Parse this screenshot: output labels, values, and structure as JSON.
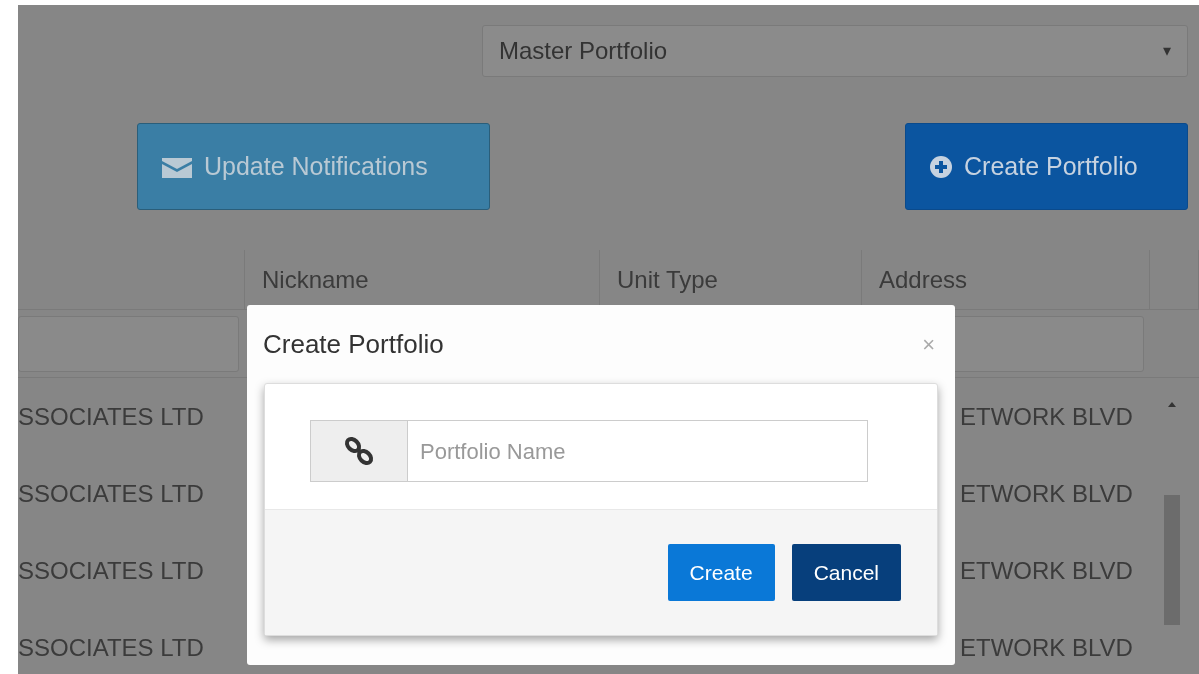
{
  "select": {
    "value": "Master Portfolio",
    "caret": "▾"
  },
  "buttons": [
    {
      "label": "Update Notifications",
      "kind": "notify"
    },
    {
      "label": "Create Portfolio",
      "kind": "create"
    }
  ],
  "table": {
    "columns": [
      "Nickname",
      "Unit Type",
      "Address"
    ],
    "rows": [
      {
        "column_1": "SSOCIATES LTD",
        "address": "ETWORK BLVD"
      },
      {
        "column_1": "SSOCIATES LTD",
        "address": "ETWORK BLVD"
      },
      {
        "column_1": "SSOCIATES LTD",
        "address": "ETWORK BLVD"
      },
      {
        "column_1": "SSOCIATES LTD",
        "address": "ETWORK BLVD"
      }
    ]
  },
  "modal": {
    "title": "Create Portfolio",
    "close": "×",
    "field": {
      "placeholder": "Portfolio Name"
    },
    "buttons": [
      {
        "label": "Create",
        "kind": "primary"
      },
      {
        "label": "Cancel",
        "kind": "secondary"
      }
    ]
  }
}
